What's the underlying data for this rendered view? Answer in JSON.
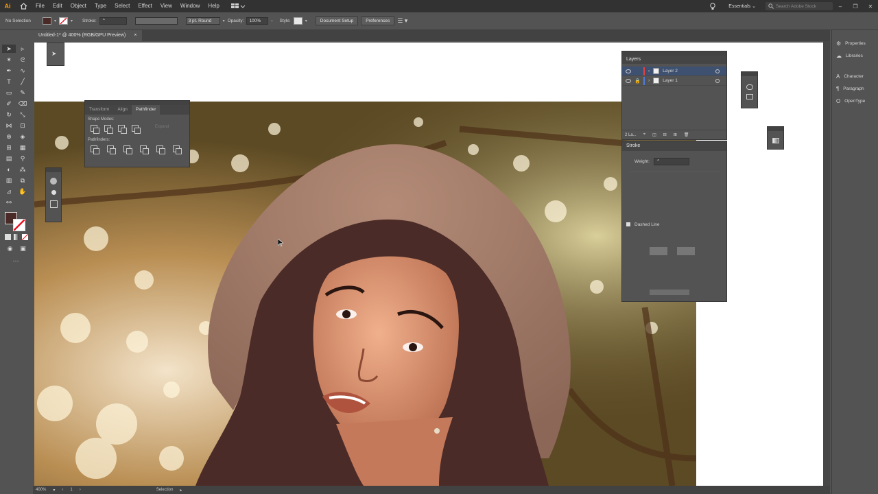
{
  "app": {
    "logo": "Ai",
    "menu": [
      "File",
      "Edit",
      "Object",
      "Type",
      "Select",
      "Effect",
      "View",
      "Window",
      "Help"
    ],
    "workspace": "Essentials",
    "search_placeholder": "Search Adobe Stock",
    "window_controls": [
      "–",
      "❐",
      "✕"
    ]
  },
  "controlbar": {
    "selection_label": "No Selection",
    "stroke_label": "Stroke:",
    "brush_value": "3 pt. Round",
    "opacity_label": "Opacity:",
    "opacity_value": "100%",
    "style_label": "Style:",
    "document_setup": "Document Setup",
    "preferences": "Preferences"
  },
  "document": {
    "tab_title": "Untitled-1* @ 400% (RGB/GPU Preview)",
    "close": "×"
  },
  "pathfinder": {
    "tabs": [
      "Transform",
      "Align",
      "Pathfinder"
    ],
    "active_tab": "Pathfinder",
    "shape_modes_label": "Shape Modes:",
    "expand_label": "Expand",
    "pathfinders_label": "Pathfinders:"
  },
  "layers": {
    "title": "Layers",
    "rows": [
      {
        "name": "Layer 2",
        "color": "#e83f3f"
      },
      {
        "name": "Layer 1",
        "color": "#4f7dd8"
      }
    ],
    "count": "2 La..."
  },
  "stroke": {
    "title": "Stroke",
    "weight_label": "Weight:",
    "dashed_line_label": "Dashed Line"
  },
  "right_panels": {
    "items": [
      {
        "label": "Properties",
        "icon": "properties-icon"
      },
      {
        "label": "Libraries",
        "icon": "libraries-icon"
      },
      {
        "label": "Character",
        "icon": "character-icon"
      },
      {
        "label": "Paragraph",
        "icon": "paragraph-icon"
      },
      {
        "label": "OpenType",
        "icon": "opentype-icon"
      }
    ]
  },
  "statusbar": {
    "zoom": "400%",
    "artboard": "1",
    "tool": "Selection"
  },
  "colors": {
    "fill": "#4a2a26",
    "ui_dark": "#323232",
    "ui_mid": "#535353",
    "hair": "#4b2b27",
    "hat": "#a07a66"
  }
}
